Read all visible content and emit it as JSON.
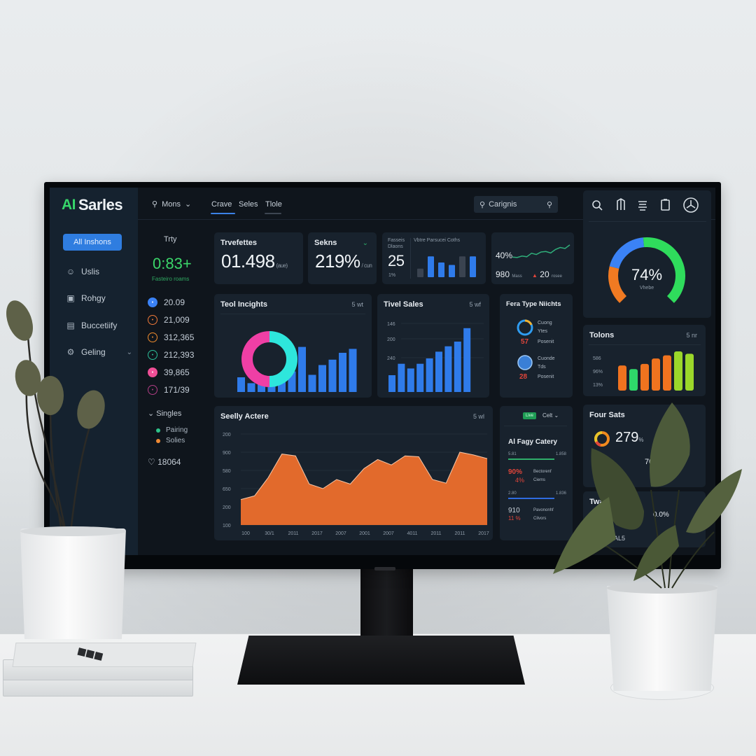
{
  "app": {
    "logo_text": "Sarles",
    "logo_mark": "AI"
  },
  "sidebar": {
    "primary_button": "All Inshons",
    "items": [
      {
        "label": "Uslis",
        "icon": "user-icon"
      },
      {
        "label": "Rohgy",
        "icon": "lock-icon"
      },
      {
        "label": "Buccetiify",
        "icon": "calendar-icon"
      },
      {
        "label": "Geling",
        "icon": "settings-icon",
        "has_chevron": true
      }
    ]
  },
  "topbar": {
    "menu_label": "Mons",
    "tabs": [
      {
        "label": "Crave",
        "active": true
      },
      {
        "label": "Seles",
        "active": false
      },
      {
        "label": "Tlole",
        "active": false
      }
    ],
    "search_placeholder": "Carignis",
    "right_icons": [
      "search-icon",
      "bookmark-icon",
      "stack-icon",
      "clipboard-icon",
      "user-circle-icon"
    ]
  },
  "left_panel": {
    "today_label": "Trty",
    "big_value": "0:83+",
    "big_sub": "Fasteiro roams",
    "metrics": [
      {
        "value": "20.09",
        "color": "#3b82f6"
      },
      {
        "value": "21,009",
        "color": "#f07a3a"
      },
      {
        "value": "312,365",
        "color": "#f08c2e"
      },
      {
        "value": "212,393",
        "color": "#2dbf9a"
      },
      {
        "value": "39,865",
        "color": "#ef4f96"
      },
      {
        "value": "171/39",
        "color": "#b23e86"
      }
    ],
    "section_label": "Singles",
    "legend": [
      {
        "label": "Pairing",
        "color": "#2fc28a"
      },
      {
        "label": "Solies",
        "color": "#f08a34"
      }
    ],
    "footer_value": "18064"
  },
  "kpis": [
    {
      "title": "Trvefettes",
      "value": "01.498",
      "unit": "(aue)"
    },
    {
      "title": "Sekns",
      "value": "219%",
      "unit": "/ cun",
      "has_chevron": true
    },
    {
      "title_left": "Fasseis Dlaons",
      "value": "25",
      "sub": "1%",
      "title_right": "Vbtre Parsucei Coths"
    }
  ],
  "sparkline_card": {
    "value": "40%",
    "bottom_left": "980",
    "bottom_left_unit": "Mass",
    "bottom_right": "20",
    "bottom_right_unit": "rosee",
    "trend_points": [
      30,
      28,
      34,
      31,
      45,
      40,
      50,
      52,
      46,
      60,
      68,
      64,
      78
    ]
  },
  "gauge": {
    "value_text": "74%",
    "label": "Vhebe",
    "percent": 74,
    "segments": [
      {
        "color": "#f07a22",
        "share": 0.22
      },
      {
        "color": "#3b82f6",
        "share": 0.26
      },
      {
        "color": "#2fdc5c",
        "share": 0.52
      }
    ]
  },
  "tool_insights": {
    "title": "Teol Incights",
    "tag": "5 wt",
    "donut": [
      {
        "color": "#ef3fa5",
        "share": 0.5
      },
      {
        "color": "#2ee6dc",
        "share": 0.5
      }
    ],
    "bars": [
      30,
      18,
      16,
      22,
      22,
      42,
      92,
      35,
      55,
      66,
      80,
      88
    ],
    "bar_color": "#2f7bea"
  },
  "tivel_sales": {
    "title": "Tivel Sales",
    "tag": "5 wf",
    "y_ticks": [
      "146",
      "200",
      "240"
    ],
    "bars": [
      25,
      42,
      35,
      42,
      50,
      60,
      68,
      75,
      95
    ],
    "bar_color": "#2f7bea"
  },
  "fera_type": {
    "title": "Fera Type Niichts",
    "items": [
      {
        "name": "Cuong",
        "sub": "Ytes",
        "value": "57",
        "label": "Posenit"
      },
      {
        "name": "Cuonde",
        "sub": "Tds",
        "value": "28",
        "label": "Posenit"
      }
    ]
  },
  "tolons": {
    "title": "Tolons",
    "tag": "5 nr",
    "y_ticks": [
      "586",
      "96%",
      "13%"
    ],
    "bars": [
      {
        "value": 64,
        "color": "#f0731f"
      },
      {
        "value": 55,
        "color": "#2ed86a"
      },
      {
        "value": 68,
        "color": "#f0731f"
      },
      {
        "value": 82,
        "color": "#f0731f"
      },
      {
        "value": 90,
        "color": "#f0731f"
      },
      {
        "value": 100,
        "color": "#9bd72a"
      },
      {
        "value": 94,
        "color": "#9bd72a"
      }
    ]
  },
  "chart_data": {
    "type": "area",
    "title": "Seelly Actere",
    "tag": "5 wl",
    "y_ticks": [
      "100",
      "200",
      "650",
      "580",
      "900",
      "200"
    ],
    "x_ticks": [
      "100",
      "30/1",
      "2011",
      "2017",
      "2007",
      "2001",
      "2007",
      "4011",
      "2011",
      "2011",
      "2017"
    ],
    "ylim": [
      0,
      100
    ],
    "values": [
      28,
      32,
      52,
      78,
      76,
      45,
      40,
      50,
      45,
      62,
      72,
      66,
      76,
      75,
      50,
      46,
      80,
      77,
      73
    ],
    "color": "#e26a2c",
    "xlabel": "",
    "ylabel": "",
    "grid": true
  },
  "category_card": {
    "badge": "Live",
    "dropdown": "Celt",
    "title": "Al Fagy Catery",
    "rows": [
      {
        "left": "5.81",
        "right": "1.858",
        "bar_color": "#2fae6a"
      },
      {
        "value": "90%",
        "sub": "4%",
        "label": "Bectorenf",
        "label2": "Ciems",
        "value_color": "#e0453a"
      },
      {
        "left": "2.80",
        "right": "1.836",
        "bar_color": "#2f6be0"
      },
      {
        "value": "910",
        "sub": "11 %",
        "label": "Pavononhf",
        "label2": "Cilvors",
        "value_color": "#c9d1d9"
      }
    ]
  },
  "four_sats": {
    "title": "Four Sats",
    "value": "279",
    "unit": "%",
    "secondary": "70%",
    "second_title": "Twater",
    "second_value": "0.0%",
    "second_footer": "AL5"
  }
}
